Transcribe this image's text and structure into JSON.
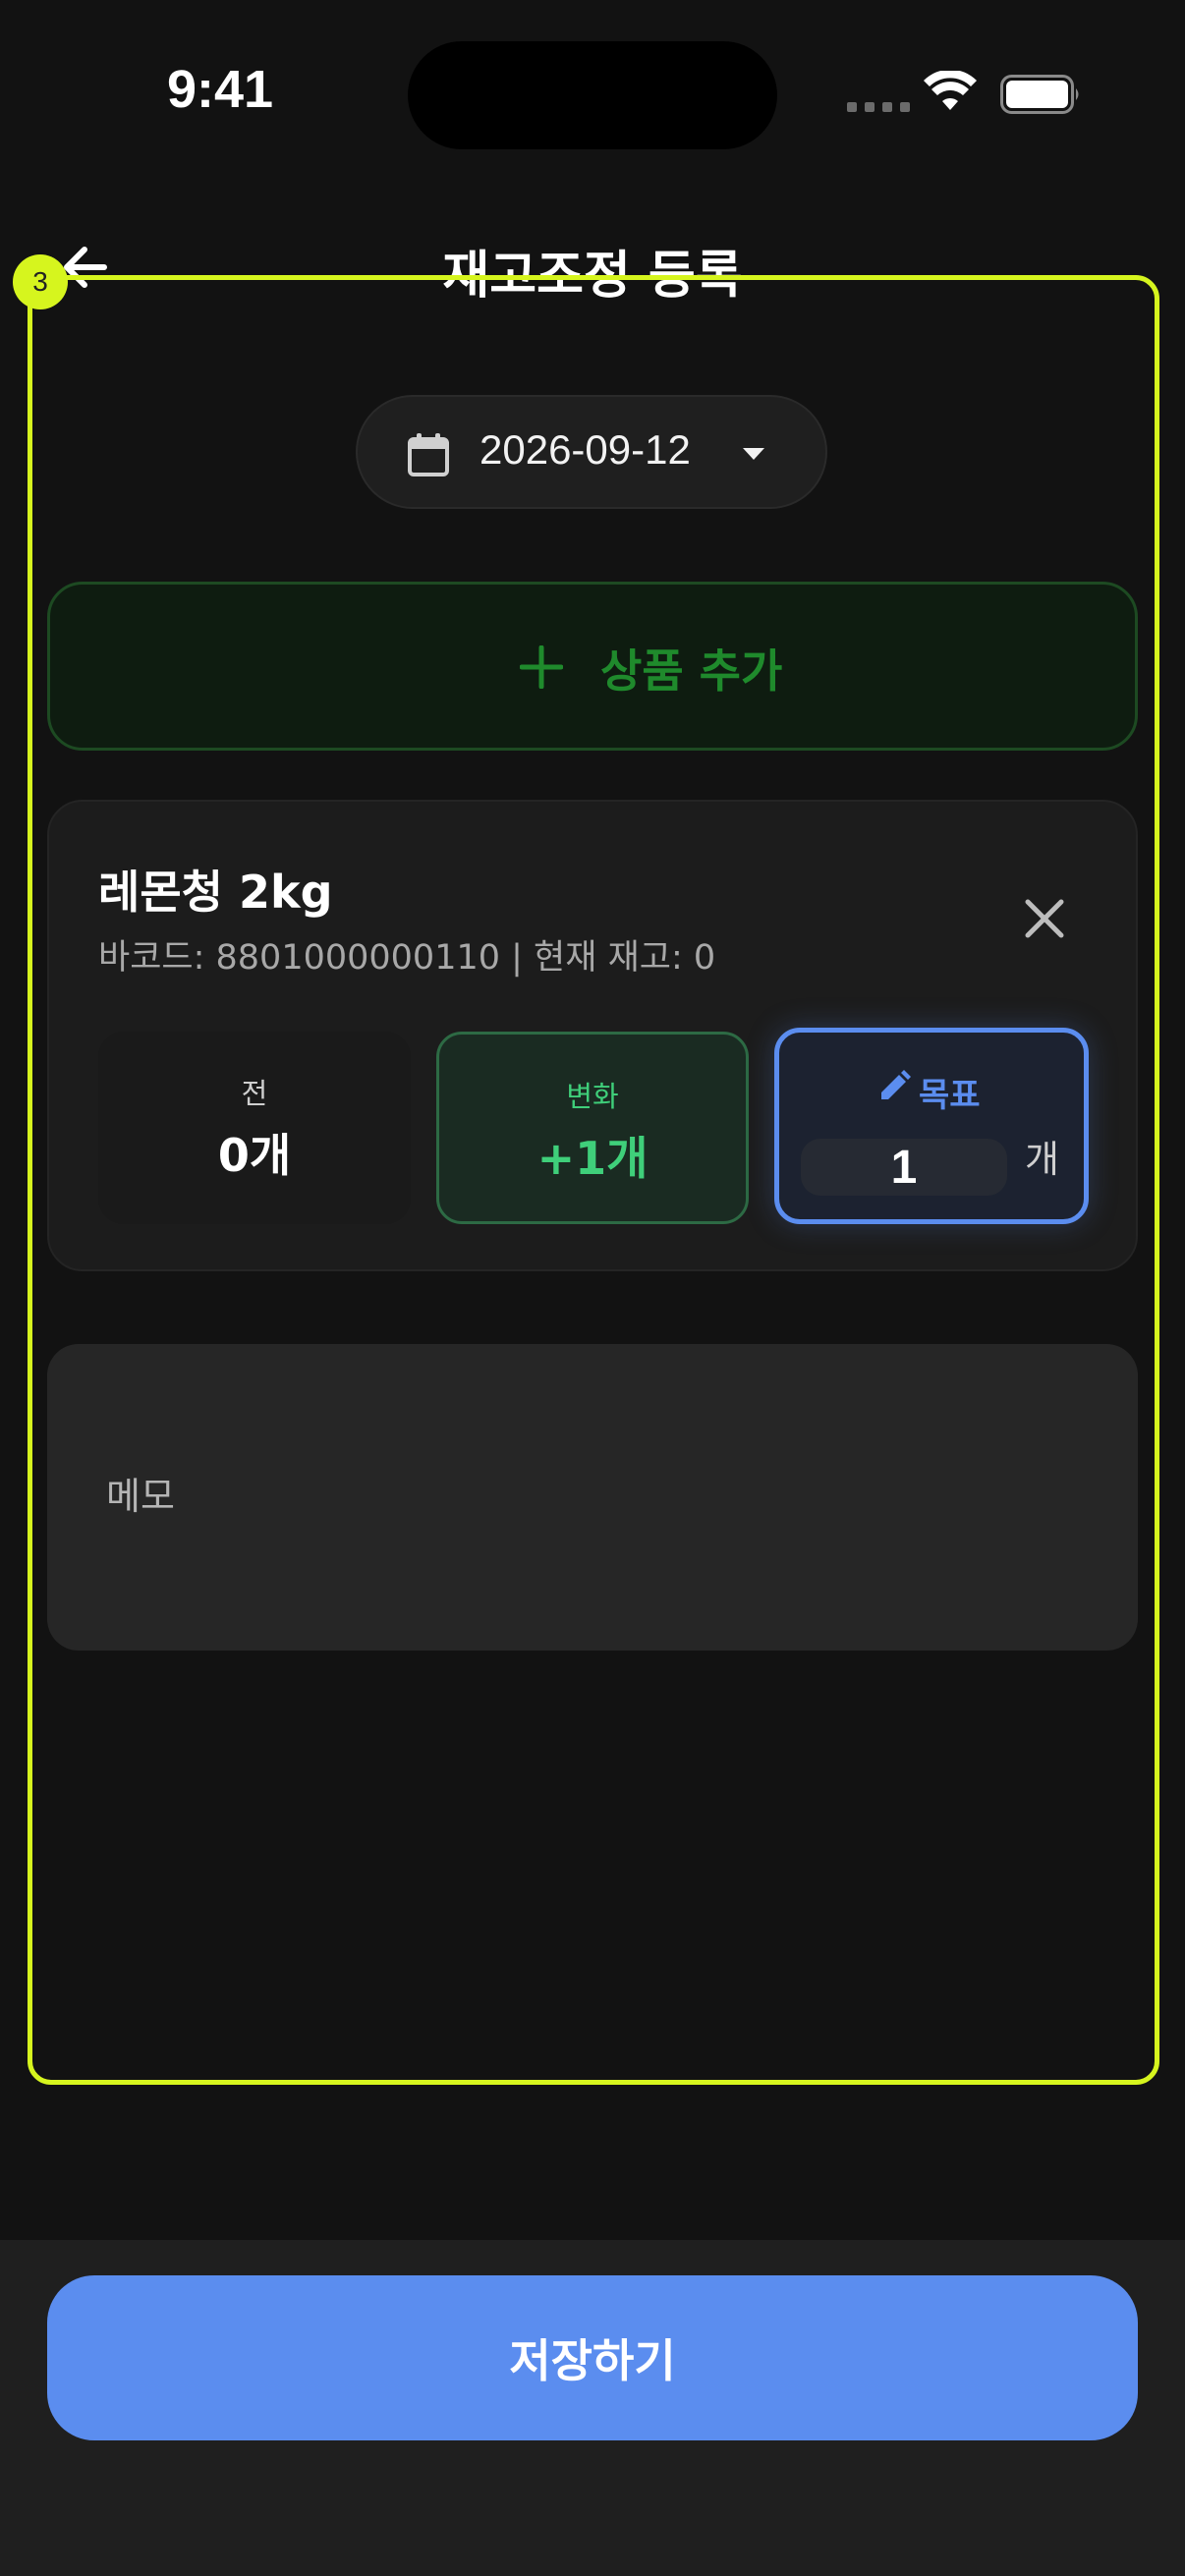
{
  "status_bar": {
    "time": "9:41",
    "signal_icon": "cellular-signal-icon",
    "wifi_icon": "wifi-icon",
    "battery_icon": "battery-icon"
  },
  "header": {
    "title": "재고조정 등록",
    "back_icon": "arrow-left-icon"
  },
  "date_picker": {
    "value": "2026-09-12",
    "icon": "calendar-icon",
    "dropdown_icon": "caret-down-icon"
  },
  "add_product": {
    "label": "상품 추가",
    "icon": "plus-icon",
    "color": "#1f8a2c"
  },
  "product": {
    "name": "레몬청 2kg",
    "meta": "바코드: 8801000000110 | 현재 재고: 0",
    "remove_icon": "close-icon",
    "before": {
      "label": "전",
      "value": "0개"
    },
    "change": {
      "label": "변화",
      "value": "+1개",
      "color": "#3fcf7a"
    },
    "target": {
      "label": "목표",
      "value": "1",
      "unit": "개",
      "icon": "pencil-icon",
      "color": "#5b8def"
    }
  },
  "memo": {
    "placeholder": "메모",
    "value": ""
  },
  "save_button": {
    "label": "저장하기",
    "color": "#5b8def"
  },
  "overlay": {
    "badge": "3",
    "color": "#d6f51e"
  }
}
